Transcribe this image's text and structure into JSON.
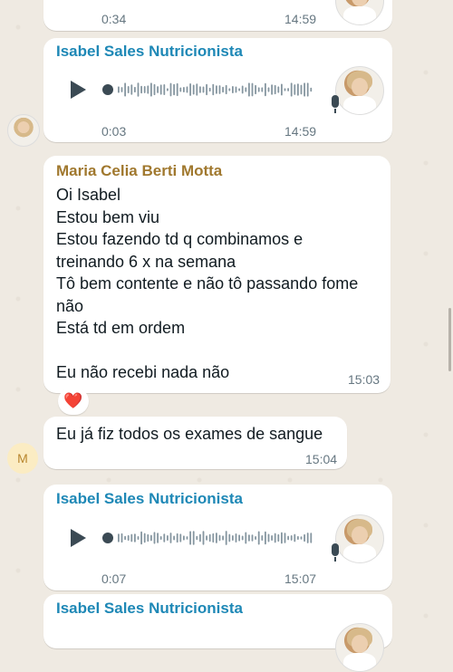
{
  "chat": {
    "top_partial": {
      "duration": "0:34",
      "time": "14:59"
    },
    "audio1": {
      "sender": "Isabel Sales Nutricionista",
      "duration": "0:03",
      "time": "14:59",
      "avatar_icon": "profile-photo-icon"
    },
    "msg1": {
      "sender": "Maria Celia Berti Motta",
      "text": "Oi Isabel\nEstou bem viu\nEstou fazendo td q combinamos e\ntreinando 6 x na semana\nTô bem contente e não tô passando fome\nnão\nEstá td em ordem\n\nEu não recebi nada não",
      "time": "15:03",
      "reaction": "❤️"
    },
    "msg2": {
      "avatar_letter": "M",
      "text": "Eu já fiz todos os exames de sangue",
      "time": "15:04"
    },
    "audio2": {
      "sender": "Isabel Sales Nutricionista",
      "duration": "0:07",
      "time": "15:07"
    },
    "bottom_partial": {
      "sender": "Isabel Sales Nutricionista"
    }
  },
  "colors": {
    "chat_bg": "#efeae2",
    "bubble": "#ffffff",
    "isabel_name": "#1e88b6",
    "maria_name": "#a0782e",
    "meta": "#667781"
  }
}
